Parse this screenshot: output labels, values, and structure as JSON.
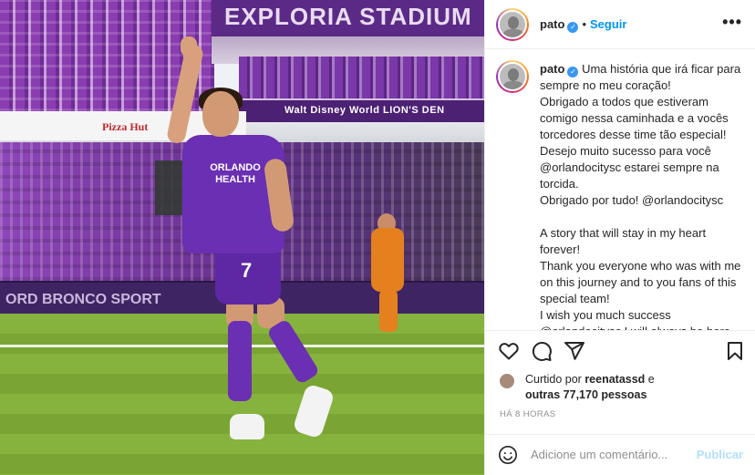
{
  "photo": {
    "stadium_sign": "EXPLORIA STADIUM",
    "deck_sign": "Walt Disney World LION'S DEN",
    "pizza_sign": "Pizza Hut",
    "ad_board": "ORD BRONCO SPORT",
    "shirt_sponsor": "ORLANDO HEALTH",
    "shirt_number": "7"
  },
  "header": {
    "username": "pato",
    "verified_glyph": "✓",
    "separator": "•",
    "follow_label": "Seguir",
    "more_glyph": "•••"
  },
  "caption": {
    "username": "pato",
    "verified_glyph": "✓",
    "text": " Uma história que irá ficar para sempre no meu coração!\nObrigado a todos que estiveram comigo nessa caminhada e a vocês torcedores desse time tão especial!\nDesejo muito sucesso para você @orlandocitysc estarei sempre na torcida.\nObrigado por tudo! @orlandocitysc\n\nA story that will stay in my heart forever!\nThank you everyone who was with me on this journey and to you fans of this special team!\nI wish you much success @orlandocitysc I will always be here cheering."
  },
  "actions": {
    "icons": [
      "heart-icon",
      "comment-icon",
      "share-icon",
      "bookmark-icon"
    ]
  },
  "likes": {
    "prefix": "Curtido por ",
    "user": "reenatassd",
    "middle": " e",
    "others": "outras 77,170 pessoas"
  },
  "time": "HÁ 8 HORAS",
  "comment_box": {
    "placeholder": "Adicione um comentário...",
    "post_label": "Publicar"
  }
}
